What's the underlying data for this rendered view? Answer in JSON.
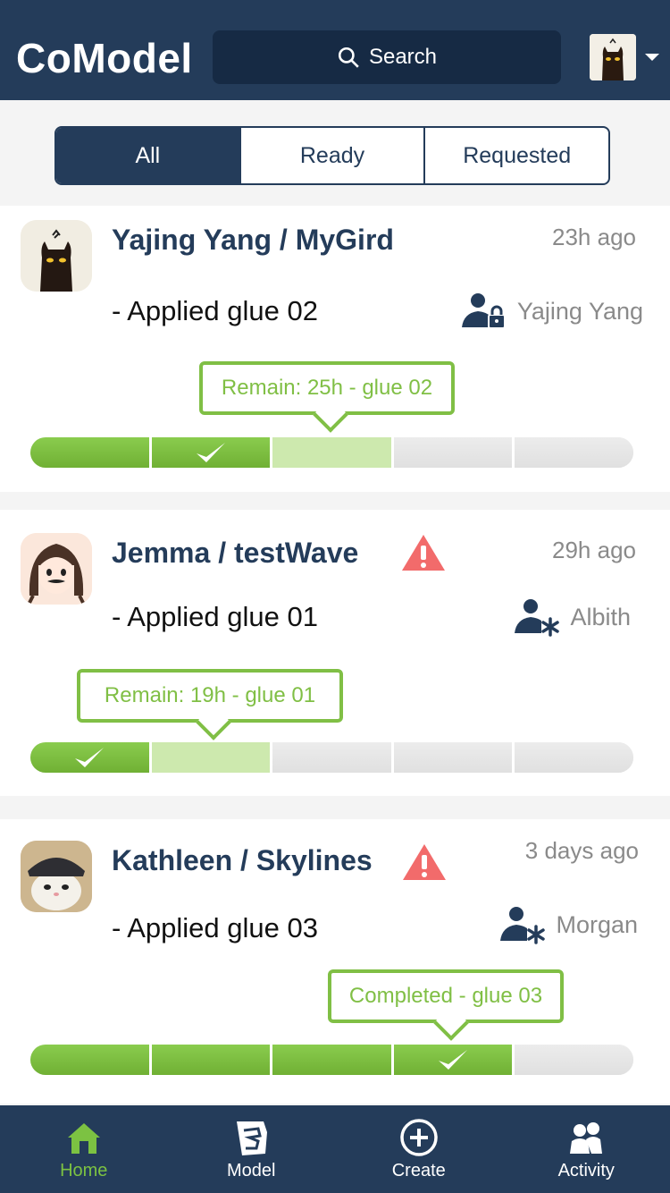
{
  "app": {
    "title": "CoModel"
  },
  "search": {
    "label": "Search"
  },
  "filters": [
    {
      "label": "All",
      "active": true
    },
    {
      "label": "Ready",
      "active": false
    },
    {
      "label": "Requested",
      "active": false
    }
  ],
  "cards": [
    {
      "title": "Yajing Yang / MyGird",
      "time": "23h ago",
      "step": "- Applied glue 02",
      "assignee": "Yajing Yang",
      "assignee_icon": "user-lock-icon",
      "warning": false,
      "tooltip": "Remain: 25h - glue 02",
      "segments": [
        "done",
        "done",
        "active",
        "pending",
        "pending"
      ],
      "check_segment": 1
    },
    {
      "title": "Jemma / testWave",
      "time": "29h ago",
      "step": "- Applied glue 01",
      "assignee": "Albith",
      "assignee_icon": "user-asterisk-icon",
      "warning": true,
      "tooltip": "Remain: 19h - glue 01",
      "segments": [
        "done",
        "active",
        "pending",
        "pending",
        "pending"
      ],
      "check_segment": 0
    },
    {
      "title": "Kathleen / Skylines",
      "time": "3 days ago",
      "step": "- Applied glue 03",
      "assignee": "Morgan",
      "assignee_icon": "user-asterisk-icon",
      "warning": true,
      "tooltip": "Completed - glue 03",
      "segments": [
        "done",
        "done",
        "done",
        "done",
        "pending"
      ],
      "check_segment": 3
    }
  ],
  "nav": [
    {
      "label": "Home",
      "icon": "home-icon",
      "active": true
    },
    {
      "label": "Model",
      "icon": "model-icon",
      "active": false
    },
    {
      "label": "Create",
      "icon": "plus-circle-icon",
      "active": false
    },
    {
      "label": "Activity",
      "icon": "users-icon",
      "active": false
    }
  ],
  "colors": {
    "navy": "#243c5a",
    "green": "#80bf45",
    "light_green": "#cde9ae",
    "warning": "#f26b6b"
  }
}
